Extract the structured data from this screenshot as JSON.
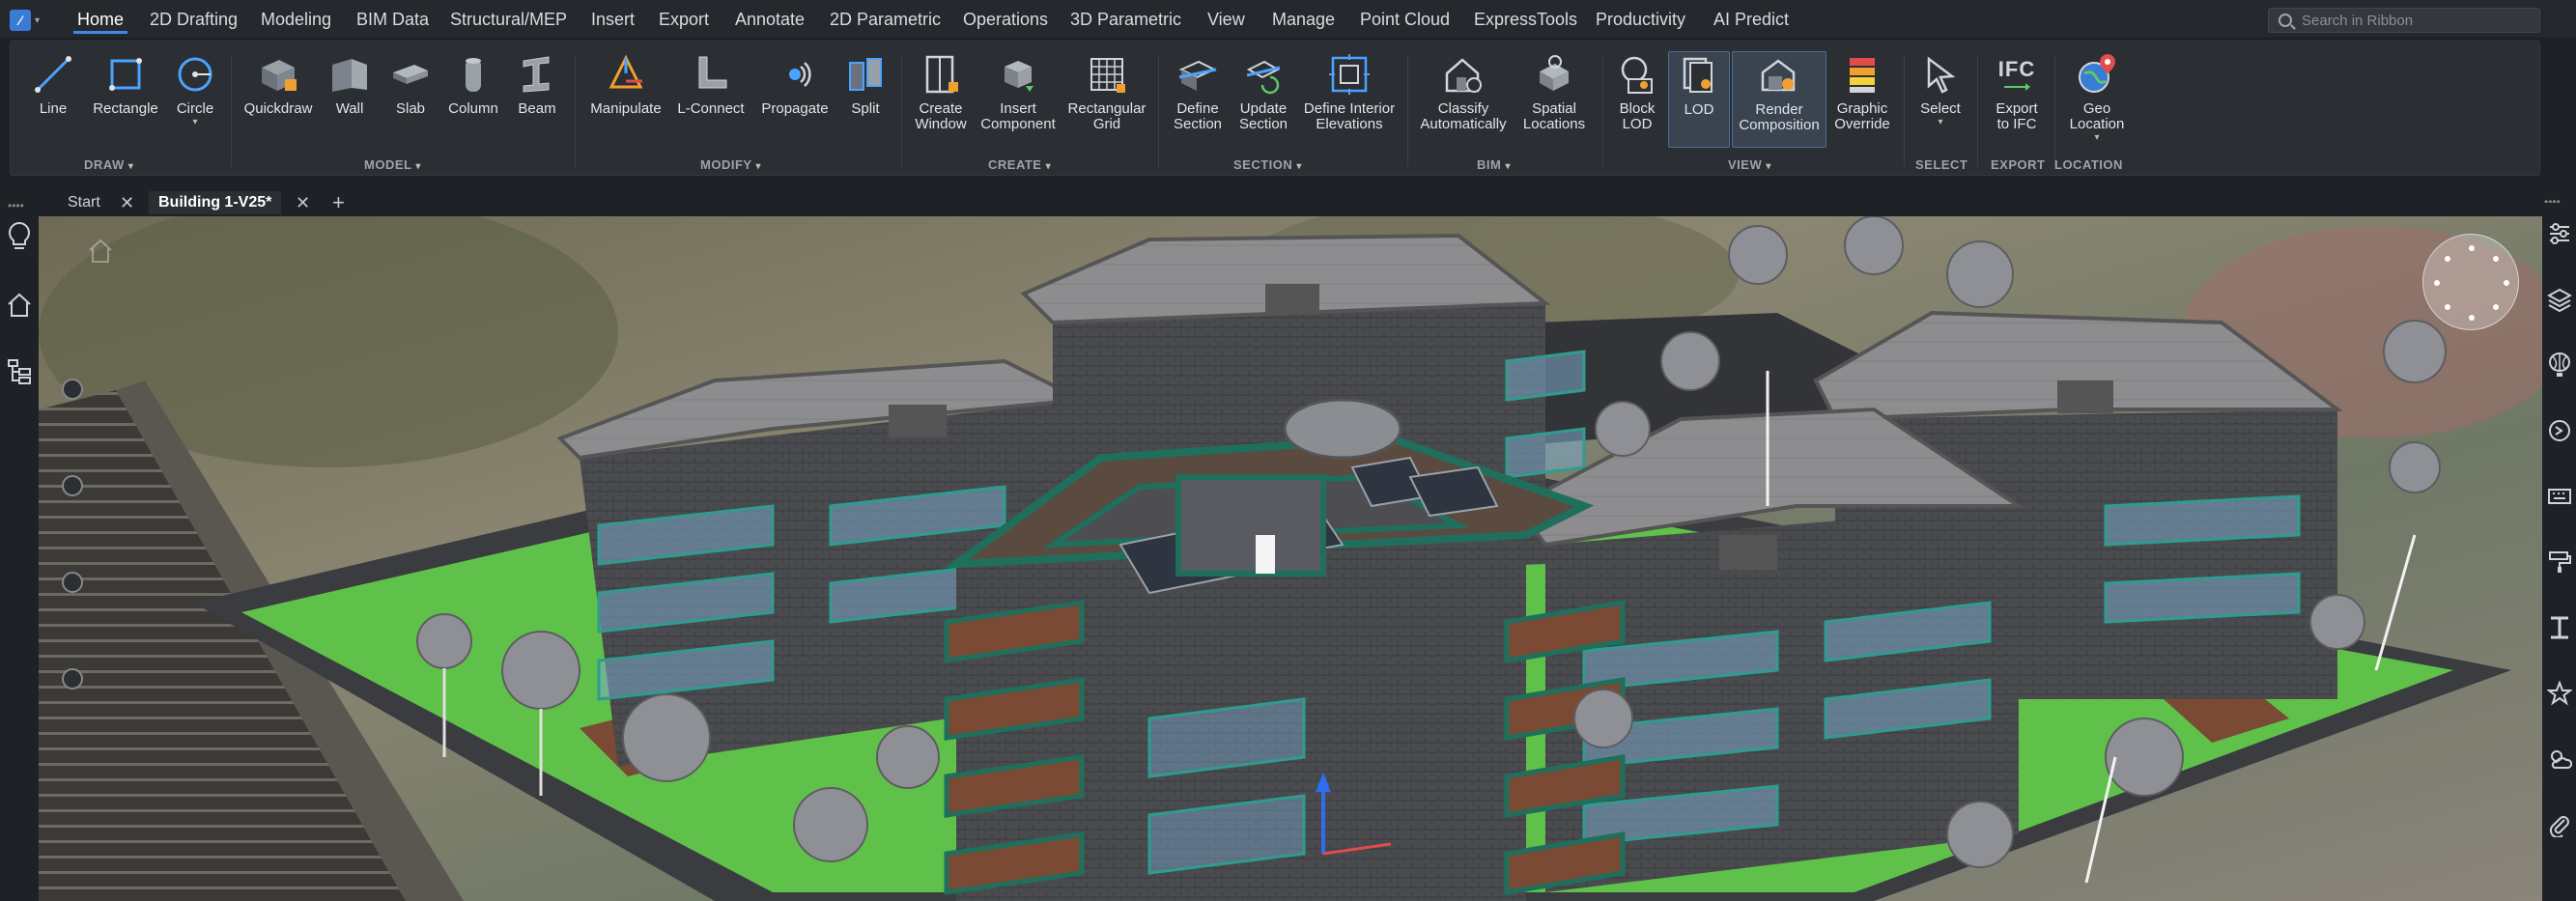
{
  "app": {
    "icon": "bricscad-logo-icon"
  },
  "menu": {
    "tabs": [
      {
        "label": "Home",
        "active": true
      },
      {
        "label": "2D Drafting"
      },
      {
        "label": "Modeling"
      },
      {
        "label": "BIM Data"
      },
      {
        "label": "Structural/MEP"
      },
      {
        "label": "Insert"
      },
      {
        "label": "Export"
      },
      {
        "label": "Annotate"
      },
      {
        "label": "2D Parametric"
      },
      {
        "label": "Operations"
      },
      {
        "label": "3D Parametric"
      },
      {
        "label": "View"
      },
      {
        "label": "Manage"
      },
      {
        "label": "Point Cloud"
      },
      {
        "label": "ExpressTools"
      },
      {
        "label": "Productivity"
      },
      {
        "label": "AI Predict"
      }
    ],
    "search_placeholder": "Search in Ribbon"
  },
  "ribbon": {
    "tools": {
      "line": "Line",
      "rectangle": "Rectangle",
      "circle": "Circle",
      "quickdraw": "Quickdraw",
      "wall": "Wall",
      "slab": "Slab",
      "column": "Column",
      "beam": "Beam",
      "manipulate": "Manipulate",
      "lconnect": "L-Connect",
      "propagate": "Propagate",
      "split": "Split",
      "create_window": [
        "Create",
        "Window"
      ],
      "insert_component": [
        "Insert",
        "Component"
      ],
      "rectangular_grid": [
        "Rectangular",
        "Grid"
      ],
      "define_section": [
        "Define",
        "Section"
      ],
      "update_section": [
        "Update",
        "Section"
      ],
      "define_interior": [
        "Define Interior",
        "Elevations"
      ],
      "classify": [
        "Classify",
        "Automatically"
      ],
      "spatial": [
        "Spatial",
        "Locations"
      ],
      "block_lod": [
        "Block",
        "LOD"
      ],
      "lod": "LOD",
      "render_comp": [
        "Render",
        "Composition"
      ],
      "graphic_override": [
        "Graphic",
        "Override"
      ],
      "select": "Select",
      "export_ifc": [
        "Export",
        "to IFC"
      ],
      "export_ifc_glyph": "IFC",
      "geo_location": [
        "Geo",
        "Location"
      ]
    },
    "groups": {
      "draw": "DRAW",
      "model": "MODEL",
      "modify": "MODIFY",
      "create": "CREATE",
      "section": "SECTION",
      "bim": "BIM",
      "view": "VIEW",
      "select": "SELECT",
      "export": "EXPORT",
      "location": "LOCATION"
    }
  },
  "doc_tabs": {
    "start": "Start",
    "building": "Building 1-V25*"
  },
  "colors": {
    "accent": "#3b8ce6",
    "grass": "#5fc14a",
    "glass_teal": "#2f9c8f",
    "roof": "#8d8d8f",
    "wall_dark": "#4a4b4f",
    "balcony_wood": "#7a4a34"
  }
}
